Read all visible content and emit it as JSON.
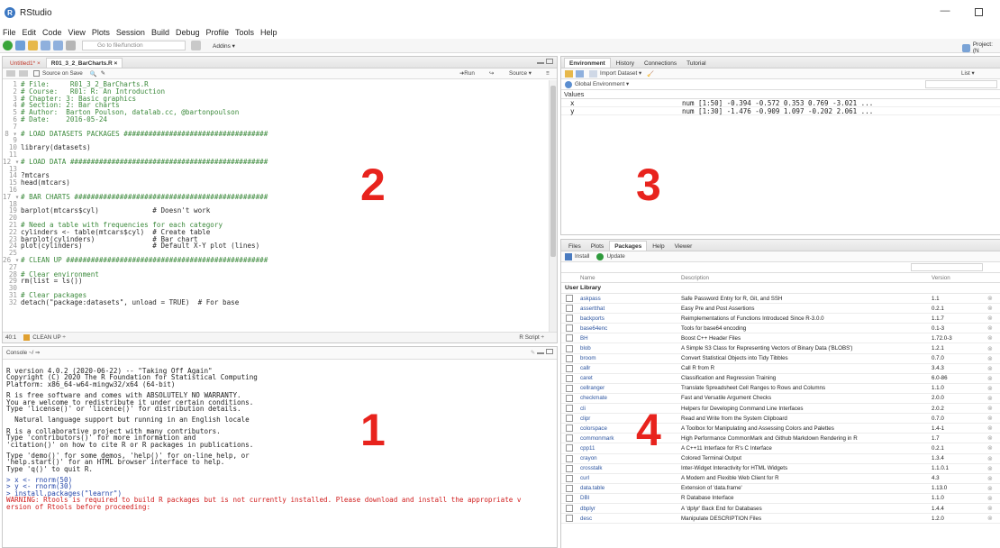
{
  "window": {
    "title": "RStudio",
    "logo": "R",
    "minimize": "—"
  },
  "menu": [
    "File",
    "Edit",
    "Code",
    "View",
    "Plots",
    "Session",
    "Build",
    "Debug",
    "Profile",
    "Tools",
    "Help"
  ],
  "toolbar": {
    "goto_placeholder": "Go to file/function",
    "addins": "Addins ▾",
    "project": "Project: (N"
  },
  "editor": {
    "tabs": [
      "Untitled1* ×",
      "R01_3_2_BarCharts.R ×"
    ],
    "source_on_save": "Source on Save",
    "run": "➜Run",
    "source": "Source ▾",
    "lines": [
      {
        "n": "1",
        "text": "# File:     R01_3_2_BarCharts.R",
        "kind": "cm"
      },
      {
        "n": "2",
        "text": "# Course:   R01: R: An Introduction",
        "kind": "cm"
      },
      {
        "n": "3",
        "text": "# Chapter: 3: Basic graphics",
        "kind": "cm"
      },
      {
        "n": "4",
        "text": "# Section: 2: Bar charts",
        "kind": "cm"
      },
      {
        "n": "5",
        "text": "# Author:  Barton Poulson, datalab.cc, @bartonpoulson",
        "kind": "cm"
      },
      {
        "n": "6",
        "text": "# Date:    2016-05-24",
        "kind": "cm"
      },
      {
        "n": "7",
        "text": "",
        "kind": "tx"
      },
      {
        "n": "8 ▾",
        "text": "# LOAD DATASETS PACKAGES ###################################",
        "kind": "cm"
      },
      {
        "n": "9",
        "text": "",
        "kind": "tx"
      },
      {
        "n": "10",
        "text": "library(datasets)",
        "kind": "tx"
      },
      {
        "n": "11",
        "text": "",
        "kind": "tx"
      },
      {
        "n": "12 ▾",
        "text": "# LOAD DATA ################################################",
        "kind": "cm"
      },
      {
        "n": "13",
        "text": "",
        "kind": "tx"
      },
      {
        "n": "14",
        "text": "?mtcars",
        "kind": "tx"
      },
      {
        "n": "15",
        "text": "head(mtcars)",
        "kind": "tx"
      },
      {
        "n": "16",
        "text": "",
        "kind": "tx"
      },
      {
        "n": "17 ▾",
        "text": "# BAR CHARTS ###############################################",
        "kind": "cm"
      },
      {
        "n": "18",
        "text": "",
        "kind": "tx"
      },
      {
        "n": "19",
        "text": "barplot(mtcars$cyl)             # Doesn't work",
        "kind": "tx"
      },
      {
        "n": "20",
        "text": "",
        "kind": "tx"
      },
      {
        "n": "21",
        "text": "# Need a table with frequencies for each category",
        "kind": "cm"
      },
      {
        "n": "22",
        "text": "cylinders <- table(mtcars$cyl)  # Create table",
        "kind": "tx"
      },
      {
        "n": "23",
        "text": "barplot(cylinders)              # Bar chart",
        "kind": "tx"
      },
      {
        "n": "24",
        "text": "plot(cylinders)                 # Default X-Y plot (lines)",
        "kind": "tx"
      },
      {
        "n": "25",
        "text": "",
        "kind": "tx"
      },
      {
        "n": "26 ▾",
        "text": "# CLEAN UP #################################################",
        "kind": "cm"
      },
      {
        "n": "27",
        "text": "",
        "kind": "tx"
      },
      {
        "n": "28",
        "text": "# Clear environment",
        "kind": "cm"
      },
      {
        "n": "29",
        "text": "rm(list = ls())",
        "kind": "tx"
      },
      {
        "n": "30",
        "text": "",
        "kind": "tx"
      },
      {
        "n": "31",
        "text": "# Clear packages",
        "kind": "cm"
      },
      {
        "n": "32",
        "text": "detach(\"package:datasets\", unload = TRUE)  # For base",
        "kind": "tx"
      }
    ],
    "status_pos": "40:1",
    "status_section": "CLEAN UP ÷",
    "status_type": "R Script ÷"
  },
  "console": {
    "title": "Console ~/ ⇒",
    "lines": [
      {
        "text": "",
        "kind": "blank"
      },
      {
        "text": "R version 4.0.2 (2020-06-22) -- \"Taking Off Again\"",
        "kind": ""
      },
      {
        "text": "Copyright (C) 2020 The R Foundation for Statistical Computing",
        "kind": ""
      },
      {
        "text": "Platform: x86_64-w64-mingw32/x64 (64-bit)",
        "kind": ""
      },
      {
        "text": "",
        "kind": "blank"
      },
      {
        "text": "R is free software and comes with ABSOLUTELY NO WARRANTY.",
        "kind": ""
      },
      {
        "text": "You are welcome to redistribute it under certain conditions.",
        "kind": ""
      },
      {
        "text": "Type 'license()' or 'licence()' for distribution details.",
        "kind": ""
      },
      {
        "text": "",
        "kind": "blank"
      },
      {
        "text": "  Natural language support but running in an English locale",
        "kind": ""
      },
      {
        "text": "",
        "kind": "blank"
      },
      {
        "text": "R is a collaborative project with many contributors.",
        "kind": ""
      },
      {
        "text": "Type 'contributors()' for more information and",
        "kind": ""
      },
      {
        "text": "'citation()' on how to cite R or R packages in publications.",
        "kind": ""
      },
      {
        "text": "",
        "kind": "blank"
      },
      {
        "text": "Type 'demo()' for some demos, 'help()' for on-line help, or",
        "kind": ""
      },
      {
        "text": "'help.start()' for an HTML browser interface to help.",
        "kind": ""
      },
      {
        "text": "Type 'q()' to quit R.",
        "kind": ""
      },
      {
        "text": "",
        "kind": "blank"
      },
      {
        "text": "> x <- rnorm(50)",
        "kind": "prompt"
      },
      {
        "text": "> y <- rnorm(30)",
        "kind": "prompt"
      },
      {
        "text": "> install.packages(\"learnr\")",
        "kind": "prompt"
      },
      {
        "text": "WARNING: Rtools is required to build R packages but is not currently installed. Please download and install the appropriate v",
        "kind": "warn"
      },
      {
        "text": "ersion of Rtools before proceeding:",
        "kind": "warn"
      }
    ]
  },
  "environment": {
    "tabs": [
      "Environment",
      "History",
      "Connections",
      "Tutorial"
    ],
    "import_dataset": "Import Dataset ▾",
    "list_label": "List ▾",
    "global_env": "Global Environment ▾",
    "section": "Values",
    "rows": [
      {
        "name": "x",
        "value": "num [1:50] -0.394 -0.572 0.353 0.769 -3.021 ..."
      },
      {
        "name": "y",
        "value": "num [1:30] -1.476 -0.909 1.097 -0.202 2.061 ..."
      }
    ]
  },
  "packages_pane": {
    "tabs": [
      "Files",
      "Plots",
      "Packages",
      "Help",
      "Viewer"
    ],
    "install": "Install",
    "update": "Update",
    "headers": {
      "name": "Name",
      "description": "Description",
      "version": "Version"
    },
    "section": "User Library",
    "rows": [
      {
        "name": "askpass",
        "desc": "Safe Password Entry for R, Git, and SSH",
        "ver": "1.1"
      },
      {
        "name": "assertthat",
        "desc": "Easy Pre and Post Assertions",
        "ver": "0.2.1"
      },
      {
        "name": "backports",
        "desc": "Reimplementations of Functions Introduced Since R-3.0.0",
        "ver": "1.1.7"
      },
      {
        "name": "base64enc",
        "desc": "Tools for base64 encoding",
        "ver": "0.1-3"
      },
      {
        "name": "BH",
        "desc": "Boost C++ Header Files",
        "ver": "1.72.0-3"
      },
      {
        "name": "blob",
        "desc": "A Simple S3 Class for Representing Vectors of Binary Data ('BLOBS')",
        "ver": "1.2.1"
      },
      {
        "name": "broom",
        "desc": "Convert Statistical Objects into Tidy Tibbles",
        "ver": "0.7.0"
      },
      {
        "name": "callr",
        "desc": "Call R from R",
        "ver": "3.4.3"
      },
      {
        "name": "caret",
        "desc": "Classification and Regression Training",
        "ver": "6.0-86"
      },
      {
        "name": "cellranger",
        "desc": "Translate Spreadsheet Cell Ranges to Rows and Columns",
        "ver": "1.1.0"
      },
      {
        "name": "checkmate",
        "desc": "Fast and Versatile Argument Checks",
        "ver": "2.0.0"
      },
      {
        "name": "cli",
        "desc": "Helpers for Developing Command Line Interfaces",
        "ver": "2.0.2"
      },
      {
        "name": "clipr",
        "desc": "Read and Write from the System Clipboard",
        "ver": "0.7.0"
      },
      {
        "name": "colorspace",
        "desc": "A Toolbox for Manipulating and Assessing Colors and Palettes",
        "ver": "1.4-1"
      },
      {
        "name": "commonmark",
        "desc": "High Performance CommonMark and Github Markdown Rendering in R",
        "ver": "1.7"
      },
      {
        "name": "cpp11",
        "desc": "A C++11 Interface for R's C Interface",
        "ver": "0.2.1"
      },
      {
        "name": "crayon",
        "desc": "Colored Terminal Output",
        "ver": "1.3.4"
      },
      {
        "name": "crosstalk",
        "desc": "Inter-Widget Interactivity for HTML Widgets",
        "ver": "1.1.0.1"
      },
      {
        "name": "curl",
        "desc": "A Modern and Flexible Web Client for R",
        "ver": "4.3"
      },
      {
        "name": "data.table",
        "desc": "Extension of 'data.frame'",
        "ver": "1.13.0"
      },
      {
        "name": "DBI",
        "desc": "R Database Interface",
        "ver": "1.1.0"
      },
      {
        "name": "dbplyr",
        "desc": "A 'dplyr' Back End for Databases",
        "ver": "1.4.4"
      },
      {
        "name": "desc",
        "desc": "Manipulate DESCRIPTION Files",
        "ver": "1.2.0"
      }
    ]
  },
  "annotations": [
    "1",
    "2",
    "3",
    "4"
  ],
  "colors": {
    "annotation": "#e8231d",
    "comment": "#3c8a3c",
    "prompt": "#2345a8",
    "warning": "#d01c1c",
    "link": "#2d55a0"
  }
}
